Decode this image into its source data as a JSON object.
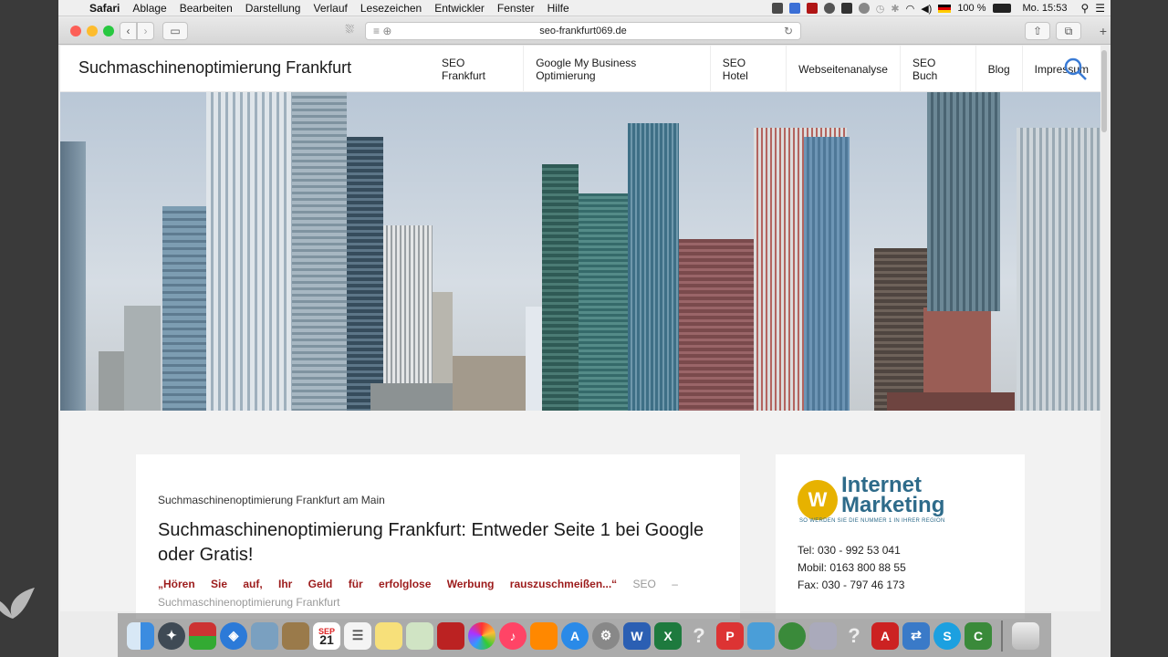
{
  "menubar": {
    "app": "Safari",
    "items": [
      "Ablage",
      "Bearbeiten",
      "Darstellung",
      "Verlauf",
      "Lesezeichen",
      "Entwickler",
      "Fenster",
      "Hilfe"
    ],
    "battery": "100 %",
    "clock": "Mo. 15:53"
  },
  "browser": {
    "url": "seo-frankfurt069.de"
  },
  "site": {
    "title": "Suchmaschinenoptimierung Frankfurt",
    "nav": [
      "SEO Frankfurt",
      "Google My Business Optimierung",
      "SEO Hotel",
      "Webseitenanalyse",
      "SEO Buch",
      "Blog",
      "Impressum"
    ]
  },
  "article": {
    "kicker": "Suchmaschinenoptimierung Frankfurt am Main",
    "headline": "Suchmaschinenoptimierung Frankfurt: Entweder Seite 1 bei Google oder Gratis!",
    "quote": "„Hören Sie auf, Ihr Geld für erfolglose Werbung rauszuschmeißen...“",
    "meta_1": "SEO –",
    "meta_2": "Suchmaschinenoptimierung Frankfurt"
  },
  "sidebar": {
    "logo_w": "W",
    "logo_line1": "Internet",
    "logo_line2": "Marketing",
    "logo_tagline": "SO WERDEN SIE DIE NUMMER 1 IN IHRER REGION",
    "tel": "Tel: 030 - 992 53 041",
    "mobil": "Mobil: 0163 800 88 55",
    "fax": "Fax: 030 - 797 46 173"
  },
  "dock": {
    "calendar_month": "SEP",
    "calendar_day": "21"
  }
}
